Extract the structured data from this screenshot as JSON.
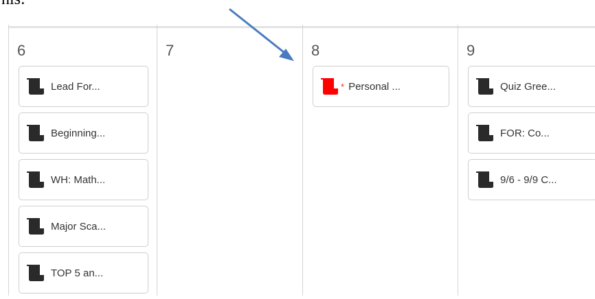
{
  "header_text": "his:",
  "colors": {
    "assignment_icon": "#2a2a2a",
    "personal_icon": "#ff0000",
    "arrow": "#4a7ac0"
  },
  "days": [
    {
      "number": "6",
      "events": [
        {
          "title": "Lead For...",
          "icon": "scroll-icon"
        },
        {
          "title": "Beginning...",
          "icon": "scroll-icon"
        },
        {
          "title": "WH: Math...",
          "icon": "scroll-icon"
        },
        {
          "title": "Major Sca...",
          "icon": "scroll-icon"
        },
        {
          "title": "TOP 5 an...",
          "icon": "scroll-icon"
        }
      ]
    },
    {
      "number": "7",
      "events": []
    },
    {
      "number": "8",
      "events": [
        {
          "title": "Personal ...",
          "icon": "scroll-icon",
          "marker": "*"
        }
      ]
    },
    {
      "number": "9",
      "events": [
        {
          "title": "Quiz Gree...",
          "icon": "scroll-icon"
        },
        {
          "title": "FOR: Co...",
          "icon": "scroll-icon"
        },
        {
          "title": "9/6 - 9/9 C...",
          "icon": "scroll-icon"
        }
      ]
    }
  ]
}
